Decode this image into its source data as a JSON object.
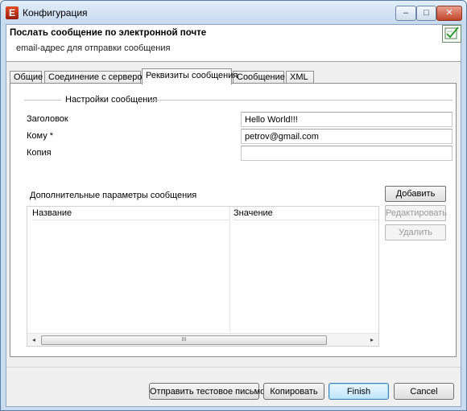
{
  "window": {
    "title": "Конфигурация",
    "app_icon_glyph": "E",
    "controls": {
      "minimize": "–",
      "maximize": "□",
      "close": "✕"
    }
  },
  "header": {
    "title": "Послать сообщение по электронной почте",
    "description": "email-адрес для отправки сообщения",
    "icon": "config-check-icon"
  },
  "tabs": [
    {
      "label": "Общие",
      "active": false
    },
    {
      "label": "Соединение с сервером",
      "active": false
    },
    {
      "label": "Реквизиты сообщения",
      "active": true
    },
    {
      "label": "Сообщение",
      "active": false
    },
    {
      "label": "XML",
      "active": false
    }
  ],
  "message_settings": {
    "group_title": "Настройки сообщения",
    "subject_label": "Заголовок",
    "subject_value": "Hello World!!!",
    "to_label": "Кому *",
    "to_value": "petrov@gmail.com",
    "cc_label": "Копия",
    "cc_value": ""
  },
  "extra_params": {
    "label": "Дополнительные параметры сообщения",
    "columns": [
      "Название",
      "Значение"
    ],
    "rows": [],
    "scroll_left": "◂",
    "scroll_right": "▸",
    "scroll_grip": "III",
    "buttons": {
      "add": "Добавить",
      "edit": "Редактировать",
      "delete": "Удалить"
    }
  },
  "footer": {
    "send_test": "Отправить тестовое письмо",
    "copy": "Копировать",
    "finish": "Finish",
    "cancel": "Cancel"
  },
  "colors": {
    "title_bar": "#c5d9ee",
    "dialog_bg": "#f0f0f0",
    "default_button": "#bee6fd"
  }
}
